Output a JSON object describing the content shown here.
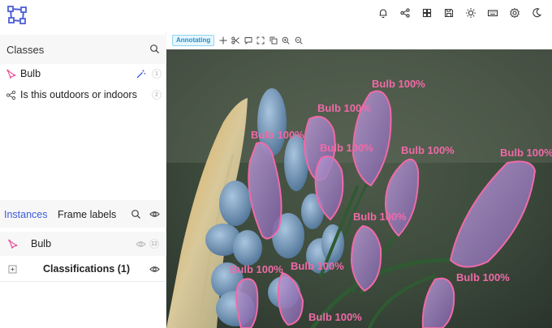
{
  "header": {
    "icons": [
      "bell-icon",
      "share-icon",
      "grid-icon",
      "save-icon",
      "sun-icon",
      "keyboard-icon",
      "gear-icon",
      "moon-icon"
    ]
  },
  "classes_panel": {
    "title": "Classes",
    "items": [
      {
        "label": "Bulb",
        "count": "1",
        "icon": "polygon-icon",
        "color": "#e8559a"
      },
      {
        "label": "Is this outdoors or indoors",
        "count": "2",
        "icon": "classification-icon",
        "color": "#555555"
      }
    ]
  },
  "instances_panel": {
    "tabs": [
      {
        "label": "Instances",
        "active": true
      },
      {
        "label": "Frame labels",
        "active": false
      }
    ],
    "instance": {
      "label": "Bulb",
      "count": "12"
    },
    "classifications": {
      "label": "Classifications (1)"
    }
  },
  "toolbar": {
    "mode": "Annotating",
    "tools": [
      "move-icon",
      "scissors-icon",
      "comment-icon",
      "fit-icon",
      "reset-icon",
      "zoom-in-icon",
      "zoom-out-icon"
    ]
  },
  "annotations": {
    "color": "#f06aa8",
    "items": [
      {
        "label": "Bulb 100%"
      },
      {
        "label": "Bulb 100%"
      },
      {
        "label": "Bulb 100%"
      },
      {
        "label": "Bulb 100%"
      },
      {
        "label": "Bulb 100%"
      },
      {
        "label": "Bulb 100%"
      },
      {
        "label": "Bulb 100%"
      },
      {
        "label": "Bulb 100%"
      },
      {
        "label": "Bulb 100%"
      },
      {
        "label": "Bulb 100%"
      },
      {
        "label": "Bulb 100%"
      }
    ]
  }
}
